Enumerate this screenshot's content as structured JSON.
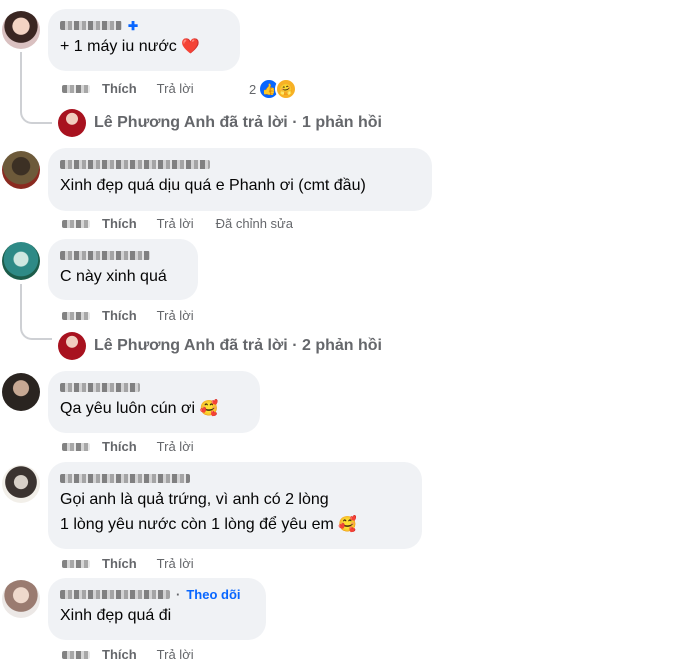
{
  "comments": [
    {
      "text": "+ 1 máy iu nước",
      "emoji": "❤️",
      "actions": {
        "like": "Thích",
        "reply": "Trả lời"
      },
      "reactions_count": "2",
      "reply_summary": "Lê Phương Anh đã trả lời · 1 phản hồi"
    },
    {
      "text": "Xinh đẹp quá dịu quá e Phanh ơi (cmt đầu)",
      "actions": {
        "like": "Thích",
        "reply": "Trả lời",
        "edited": "Đã chỉnh sửa"
      }
    },
    {
      "text": "C này xinh quá",
      "actions": {
        "like": "Thích",
        "reply": "Trả lời"
      },
      "reply_summary": "Lê Phương Anh đã trả lời · 2 phản hồi"
    },
    {
      "text": "Qa yêu luôn cún ơi",
      "emoji": "🥰",
      "actions": {
        "like": "Thích",
        "reply": "Trả lời"
      }
    },
    {
      "text_line1": "Gọi anh là quả trứng, vì anh có 2 lòng",
      "text_line2": "1 lòng yêu nước còn 1 lòng để yêu em",
      "emoji": "🥰",
      "actions": {
        "like": "Thích",
        "reply": "Trả lời"
      }
    },
    {
      "follow": "Theo dõi",
      "text": "Xinh đẹp quá đi",
      "actions": {
        "like": "Thích",
        "reply": "Trả lời"
      }
    }
  ],
  "colors": {
    "bubble": "#f0f2f5",
    "secondary_text": "#65676b",
    "follow_link": "#0866ff",
    "thread_line": "#ced0d4"
  }
}
